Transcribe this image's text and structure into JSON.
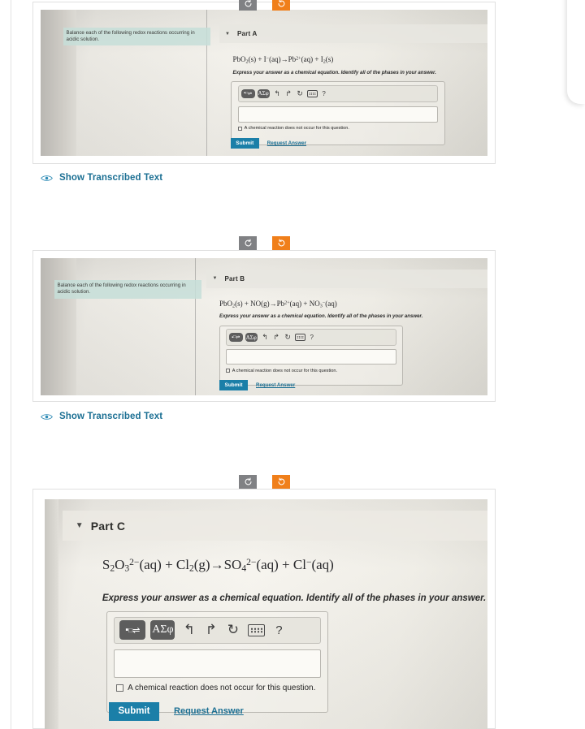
{
  "page": {
    "background": "#ffffff",
    "accent_teal": "#1b7fa8",
    "accent_orange": "#F07F1A",
    "accent_gray": "#808184",
    "highlight_mint": "#c5ded8"
  },
  "rotate_controls": {
    "rotate_left_label": "↺",
    "rotate_right_label": "↻",
    "rotate_left_name": "rotate-counterclockwise",
    "rotate_right_name": "rotate-clockwise"
  },
  "transcription": {
    "label": "Show Transcribed Text",
    "icon": "eye-icon"
  },
  "worksheet": {
    "prompt": "Balance each of the following redox reactions occurring in acidic solution.",
    "instruction": "Express your answer as a chemical equation. Identify all of the phases in your answer.",
    "checkbox_label": "A chemical reaction does not occur for this question.",
    "submit_label": "Submit",
    "request_answer_label": "Request Answer",
    "caret": "▼",
    "toolbar": {
      "template_label": "▪",
      "template_sup": "□",
      "equilibrium": "⇌",
      "greek_label": "ΑΣφ",
      "undo": "↰",
      "redo": "↱",
      "reset": "↻",
      "keyboard": "keyboard-icon",
      "help": "?"
    }
  },
  "parts": [
    {
      "id": "part-a",
      "label": "Part A",
      "equation_html": "PbO<sub>2</sub>(s) + I<sup>−</sup>(aq)→Pb<sup>2+</sup>(aq) + I<sub>2</sub>(s)",
      "equation_text": "PbO2(s) + I-(aq)→Pb2+(aq) + I2(s)"
    },
    {
      "id": "part-b",
      "label": "Part B",
      "equation_html": "PbO<sub>2</sub>(s) + NO(g)→Pb<sup>2+</sup>(aq) + NO<sub>3</sub><sup>−</sup>(aq)",
      "equation_text": "PbO2(s) + NO(g)→Pb2+(aq) + NO3-(aq)"
    },
    {
      "id": "part-c",
      "label": "Part C",
      "equation_html": "S<sub>2</sub>O<sub>3</sub><sup>2−</sup>(aq) + Cl<sub>2</sub>(g)→SO<sub>4</sub><sup>2−</sup>(aq) + Cl<sup>−</sup>(aq)",
      "equation_text": "S2O3 2-(aq) + Cl2(g)→SO4 2-(aq) + Cl-(aq)"
    }
  ]
}
